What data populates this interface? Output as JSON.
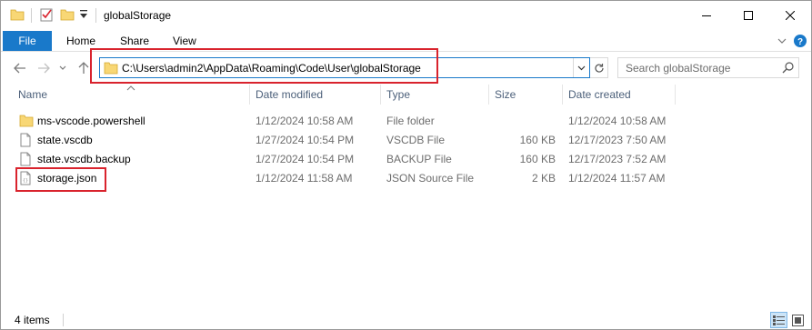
{
  "window": {
    "title": "globalStorage"
  },
  "ribbon": {
    "tabs": [
      "File",
      "Home",
      "Share",
      "View"
    ]
  },
  "address": {
    "path": "C:\\Users\\admin2\\AppData\\Roaming\\Code\\User\\globalStorage"
  },
  "search": {
    "placeholder": "Search globalStorage"
  },
  "columns": {
    "name": "Name",
    "modified": "Date modified",
    "type": "Type",
    "size": "Size",
    "created": "Date created"
  },
  "files": [
    {
      "name": "ms-vscode.powershell",
      "modified": "1/12/2024 10:58 AM",
      "type": "File folder",
      "size": "",
      "created": "1/12/2024 10:58 AM",
      "icon": "folder-icon"
    },
    {
      "name": "state.vscdb",
      "modified": "1/27/2024 10:54 PM",
      "type": "VSCDB File",
      "size": "160 KB",
      "created": "12/17/2023 7:50 AM",
      "icon": "file-icon"
    },
    {
      "name": "state.vscdb.backup",
      "modified": "1/27/2024 10:54 PM",
      "type": "BACKUP File",
      "size": "160 KB",
      "created": "12/17/2023 7:52 AM",
      "icon": "file-icon"
    },
    {
      "name": "storage.json",
      "modified": "1/12/2024 11:58 AM",
      "type": "JSON Source File",
      "size": "2 KB",
      "created": "1/12/2024 11:57 AM",
      "icon": "json-file-icon"
    }
  ],
  "status": {
    "item_count": "4 items"
  },
  "colors": {
    "accent": "#1979ca",
    "highlight_box": "#d9232d",
    "folder": "#f8d775"
  }
}
